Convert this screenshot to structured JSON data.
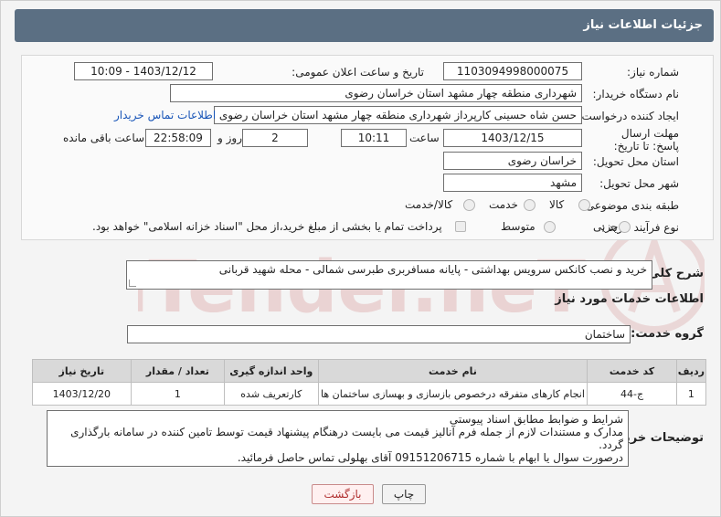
{
  "header": {
    "title": "جزئیات اطلاعات نیاز"
  },
  "form": {
    "need_number_label": "شماره نیاز:",
    "need_number": "1103094998000075",
    "announce_label": "تاریخ و ساعت اعلان عمومی:",
    "announce_value": "1403/12/12 - 10:09",
    "buyer_org_label": "نام دستگاه خریدار:",
    "buyer_org": "شهرداری منطقه چهار مشهد استان خراسان رضوی",
    "requester_label": "ایجاد کننده درخواست:",
    "requester": "حسن شاه حسینی کارپرداز شهرداری منطقه چهار مشهد استان خراسان رضوی",
    "contact_link": "اطلاعات تماس خریدار",
    "deadline_label": "مهلت ارسال پاسخ: تا تاریخ:",
    "deadline_date": "1403/12/15",
    "time_label": "ساعت",
    "deadline_time": "10:11",
    "days_value": "2",
    "days_label": "روز و",
    "remaining_time": "22:58:09",
    "remaining_label": "ساعت باقی مانده",
    "province_label": "استان محل تحویل:",
    "province": "خراسان رضوی",
    "city_label": "شهر محل تحویل:",
    "city": "مشهد",
    "category_label": "طبقه بندی موضوعی:",
    "category_options": [
      "کالا",
      "خدمت",
      "کالا/خدمت"
    ],
    "process_label": "نوع فرآیند خرید :",
    "process_options": [
      "جزیی",
      "متوسط"
    ],
    "payment_note": "پرداخت تمام یا بخشی از مبلغ خرید،از محل \"اسناد خزانه اسلامی\" خواهد بود."
  },
  "description": {
    "label": "شرح کلی نیاز:",
    "text": "خرید و نصب کانکس سرویس بهداشتی - پایانه مسافربری طبرسی شمالی - محله شهید قربانی"
  },
  "services": {
    "section_title": "اطلاعات خدمات مورد نیاز",
    "group_label": "گروه خدمت:",
    "group_value": "ساختمان",
    "columns": [
      "ردیف",
      "کد خدمت",
      "نام خدمت",
      "واحد اندازه گیری",
      "تعداد / مقدار",
      "تاریخ نیاز"
    ],
    "rows": [
      [
        "1",
        "ج-44",
        "انجام کارهای متفرقه درخصوص بازسازی و بهسازی ساختمان ها",
        "کارتعریف شده",
        "1",
        "1403/12/20"
      ]
    ]
  },
  "buyer_notes": {
    "label": "توضیحات خریدار:",
    "lines": [
      "شرایط و ضوابط مطابق اسناد پیوستی",
      "مدارک و مستندات لازم از جمله فرم آنالیز قیمت می بایست درهنگام پیشنهاد قیمت توسط تامین کننده در سامانه بارگذاری گردد.",
      "درصورت سوال یا ابهام با شماره 09151206715 آقای بهلولی  تماس حاصل فرمائید."
    ]
  },
  "buttons": {
    "print": "چاپ",
    "back": "بازگشت"
  },
  "colors": {
    "header_bg": "#5b6f83",
    "link": "#1a56b8",
    "watermark": "#e8c9c9"
  }
}
